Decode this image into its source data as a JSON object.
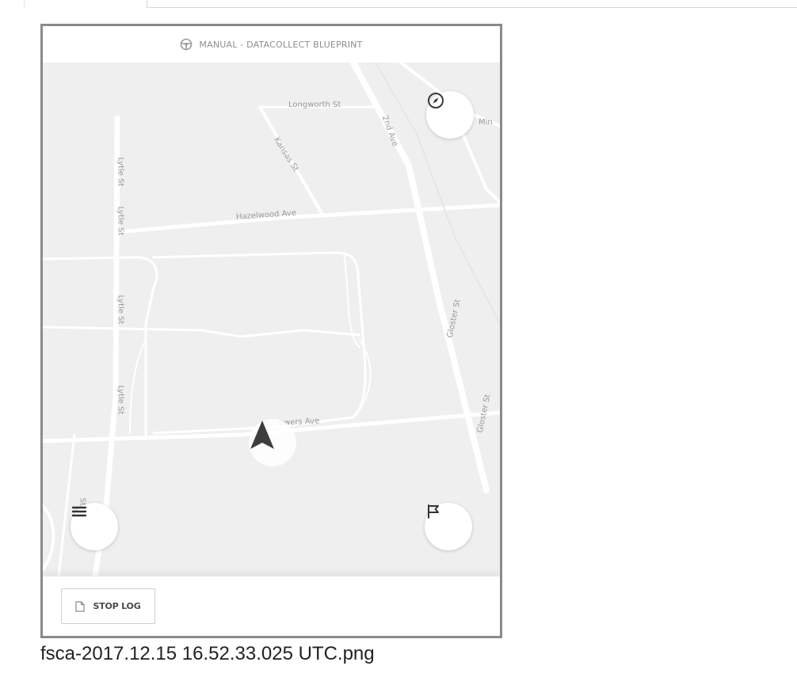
{
  "header": {
    "title": "MANUAL - DATACOLLECT BLUEPRINT",
    "icon": "steering-wheel-icon"
  },
  "map": {
    "streets": {
      "longworth": "Longworth St",
      "second_ave": "2nd Ave",
      "kansas": "Kansas St",
      "min": "Min",
      "lytle_1": "Lytle St",
      "lytle_2": "Lytle St",
      "lytle_3": "Lytle St",
      "lytle_4": "Lytle St",
      "hazelwood": "Hazelwood Ave",
      "gloster_1": "Gloster St",
      "gloster_2": "Gloster St",
      "flowers": "owers Ave",
      "st_bottom": "St"
    },
    "buttons": {
      "compass": "compass-icon",
      "menu": "menu-icon",
      "flag": "flag-icon"
    }
  },
  "bottom_bar": {
    "stop_log_label": "STOP LOG",
    "stop_log_icon": "document-icon"
  },
  "caption": "fsca-2017.12.15 16.52.33.025 UTC.png"
}
